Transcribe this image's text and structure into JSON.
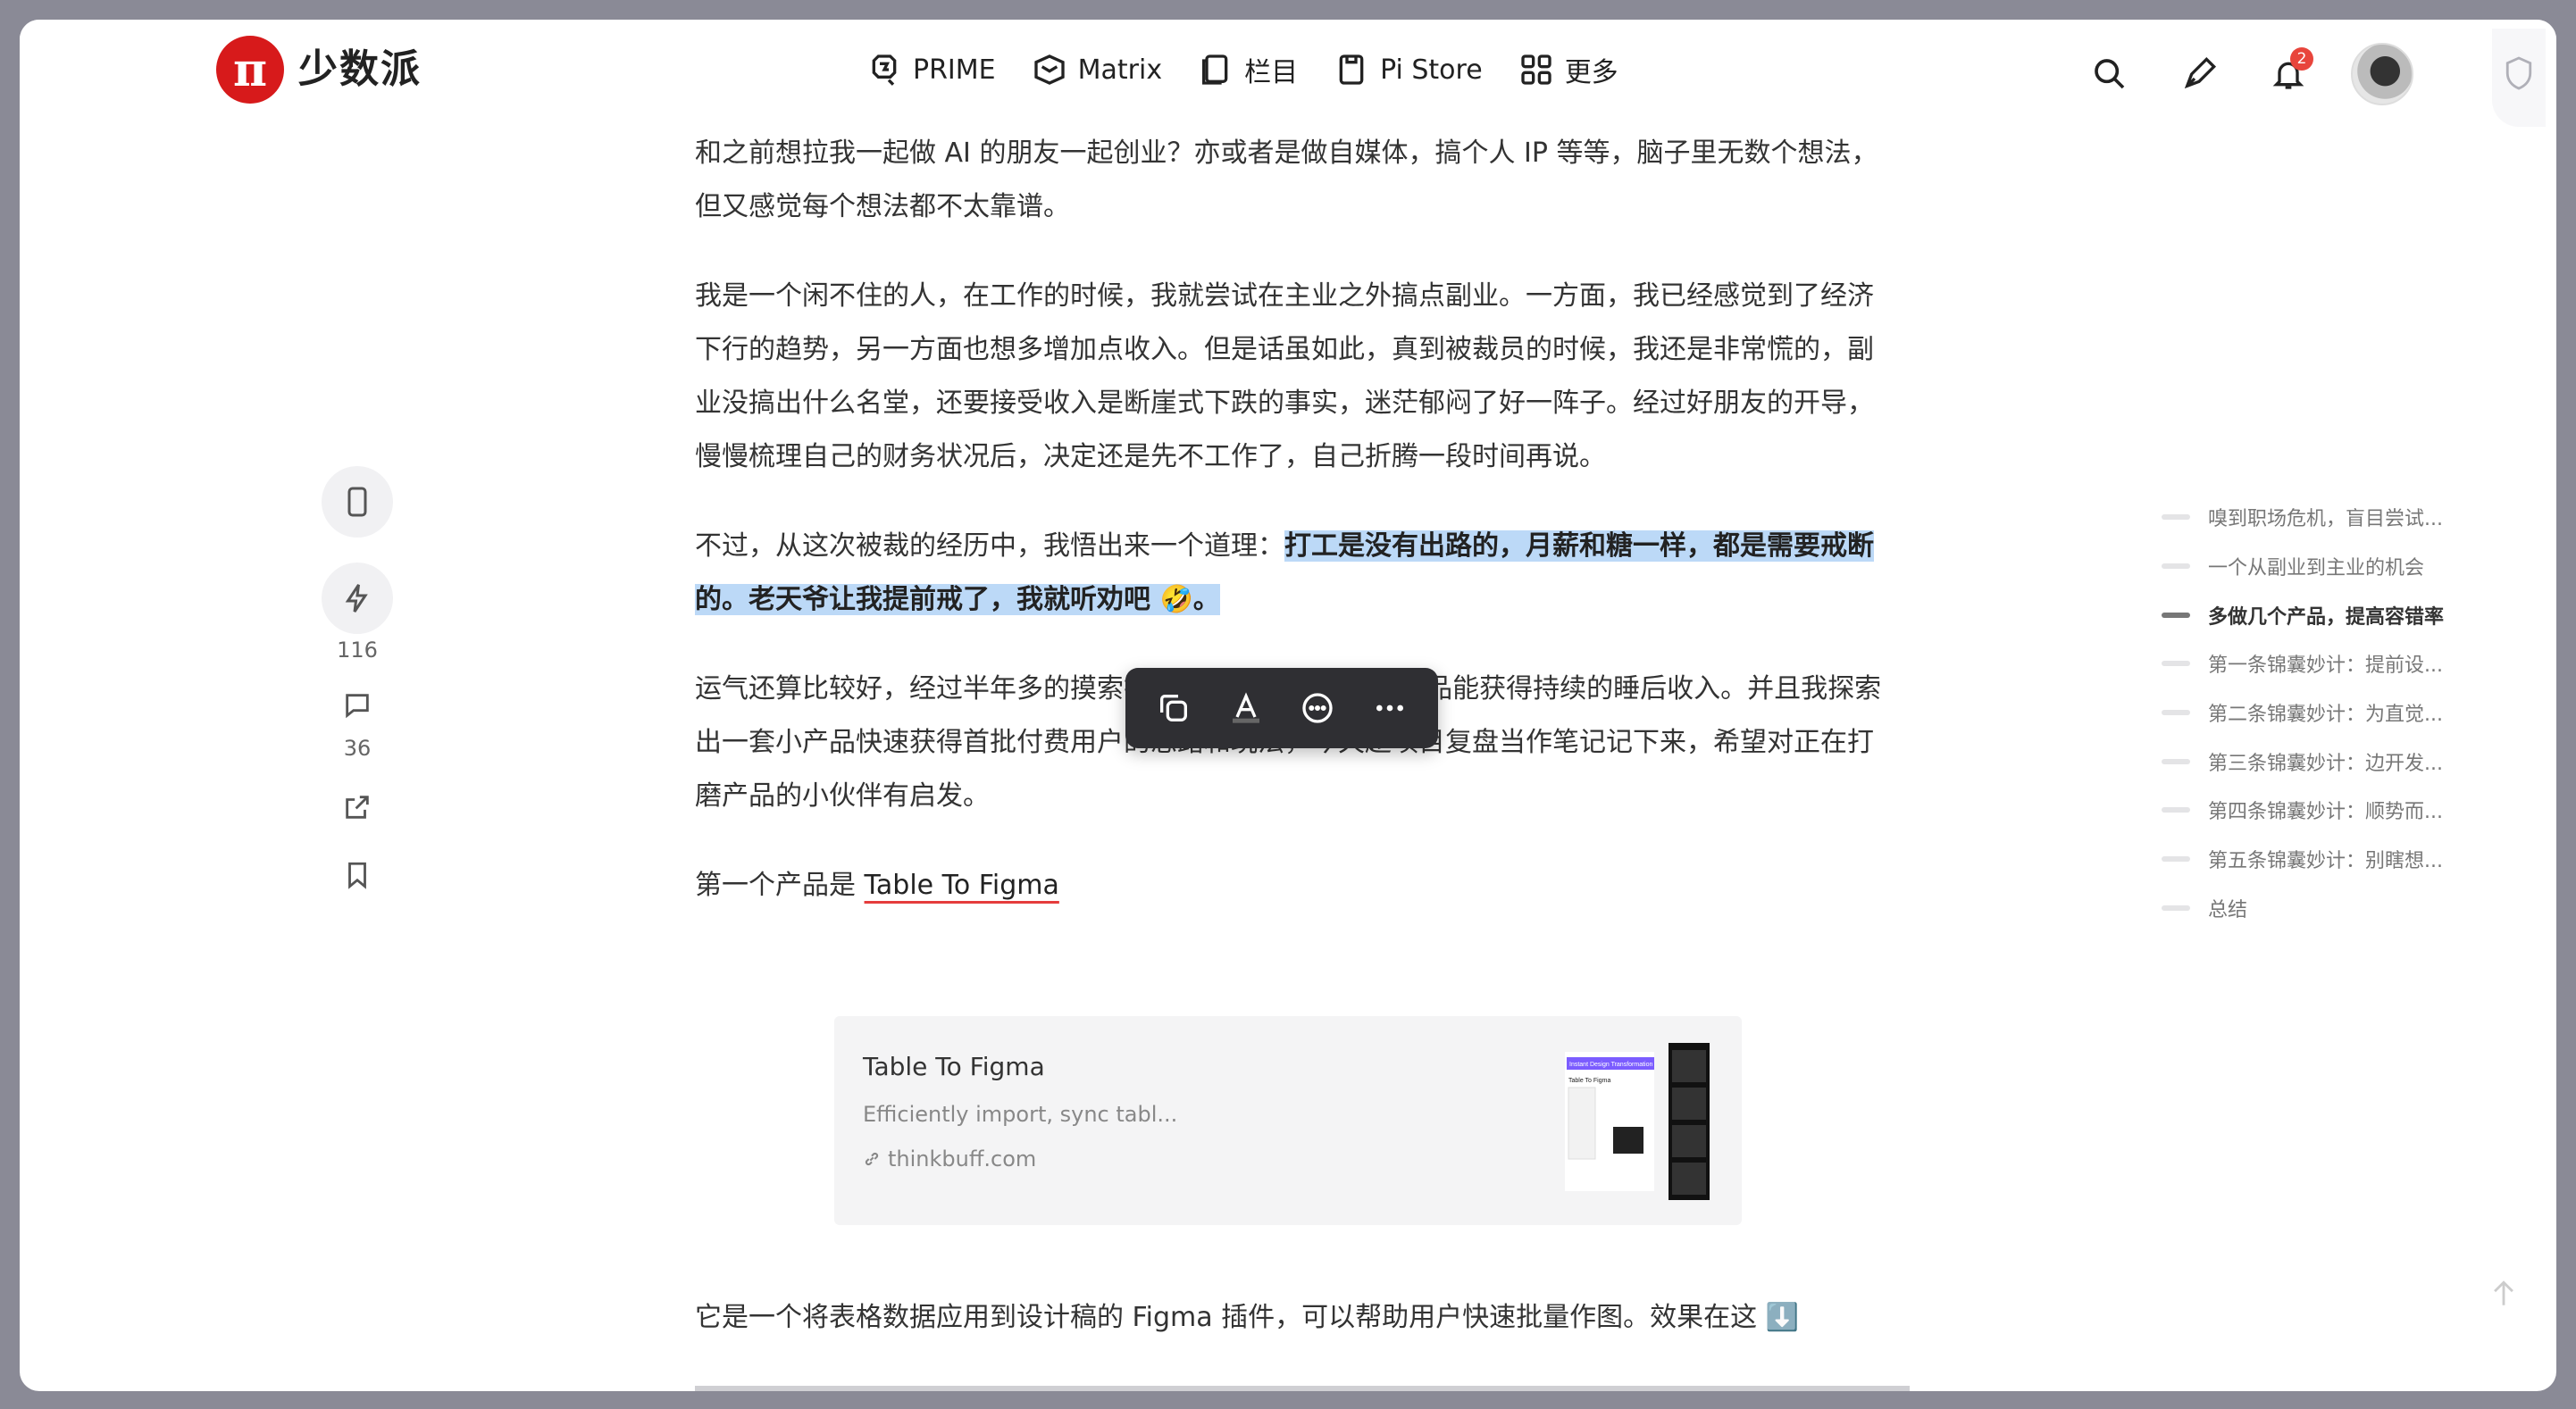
{
  "header": {
    "logo_symbol": "π",
    "logo_text": "少数派",
    "nav": [
      {
        "label": "PRIME",
        "icon": "prime-icon"
      },
      {
        "label": "Matrix",
        "icon": "matrix-icon"
      },
      {
        "label": "栏目",
        "icon": "column-icon"
      },
      {
        "label": "Pi Store",
        "icon": "store-icon"
      },
      {
        "label": "更多",
        "icon": "grid-icon"
      }
    ],
    "notification_count": "2"
  },
  "rail": {
    "like_count": "116",
    "comment_count": "36"
  },
  "article": {
    "p1": "和之前想拉我一起做 AI 的朋友一起创业？亦或者是做自媒体，搞个人 IP 等等，脑子里无数个想法，但又感觉每个想法都不太靠谱。",
    "p2": "我是一个闲不住的人，在工作的时候，我就尝试在主业之外搞点副业。一方面，我已经感觉到了经济下行的趋势，另一方面也想多增加点收入。但是话虽如此，真到被裁员的时候，我还是非常慌的，副业没搞出什么名堂，还要接受收入是断崖式下跌的事实，迷茫郁闷了好一阵子。经过好朋友的开导，慢慢梳理自己的财务状况后，决定还是先不工作了，自己折腾一段时间再说。",
    "p3_plain": "不过，从这次被裁的经历中，我悟出来一个道理：",
    "p3_highlight": "打工是没有出路的，月薪和糖一样，都是需要戒断的。老天爷让我提前戒了，我就听劝吧 🤣。",
    "p4": "运气还算比较好，经过半年多的摸索打磨，现在已经有 3 个产品能获得持续的睡后收入。并且我探索出一套小产品快速获得首批付费用户的思路和玩法，今天趁项目复盘当作笔记记下来，希望对正在打磨产品的小伙伴有启发。",
    "p5_plain": "第一个产品是 ",
    "p5_link": "Table To Figma",
    "p6": "它是一个将表格数据应用到设计稿的 Figma 插件，可以帮助用户快速批量作图。效果在这 ⬇️"
  },
  "card": {
    "title": "Table To Figma",
    "description": "Efficiently import, sync tabl...",
    "url": "thinkbuff.com",
    "thumb_heading": "Instant Design Transformation",
    "thumb_sub": "Table To Figma"
  },
  "toc": [
    {
      "label": "嗅到职场危机，盲目尝试...",
      "active": false
    },
    {
      "label": "一个从副业到主业的机会",
      "active": false
    },
    {
      "label": "多做几个产品，提高容错率",
      "active": true
    },
    {
      "label": "第一条锦囊妙计：提前设...",
      "active": false
    },
    {
      "label": "第二条锦囊妙计：为直觉...",
      "active": false
    },
    {
      "label": "第三条锦囊妙计：边开发...",
      "active": false
    },
    {
      "label": "第四条锦囊妙计：顺势而...",
      "active": false
    },
    {
      "label": "第五条锦囊妙计：别瞎想...",
      "active": false
    },
    {
      "label": "总结",
      "active": false
    }
  ],
  "colors": {
    "brand": "#d71a1b",
    "highlight": "#bcd9f7",
    "toolbar": "#2f2f33"
  }
}
